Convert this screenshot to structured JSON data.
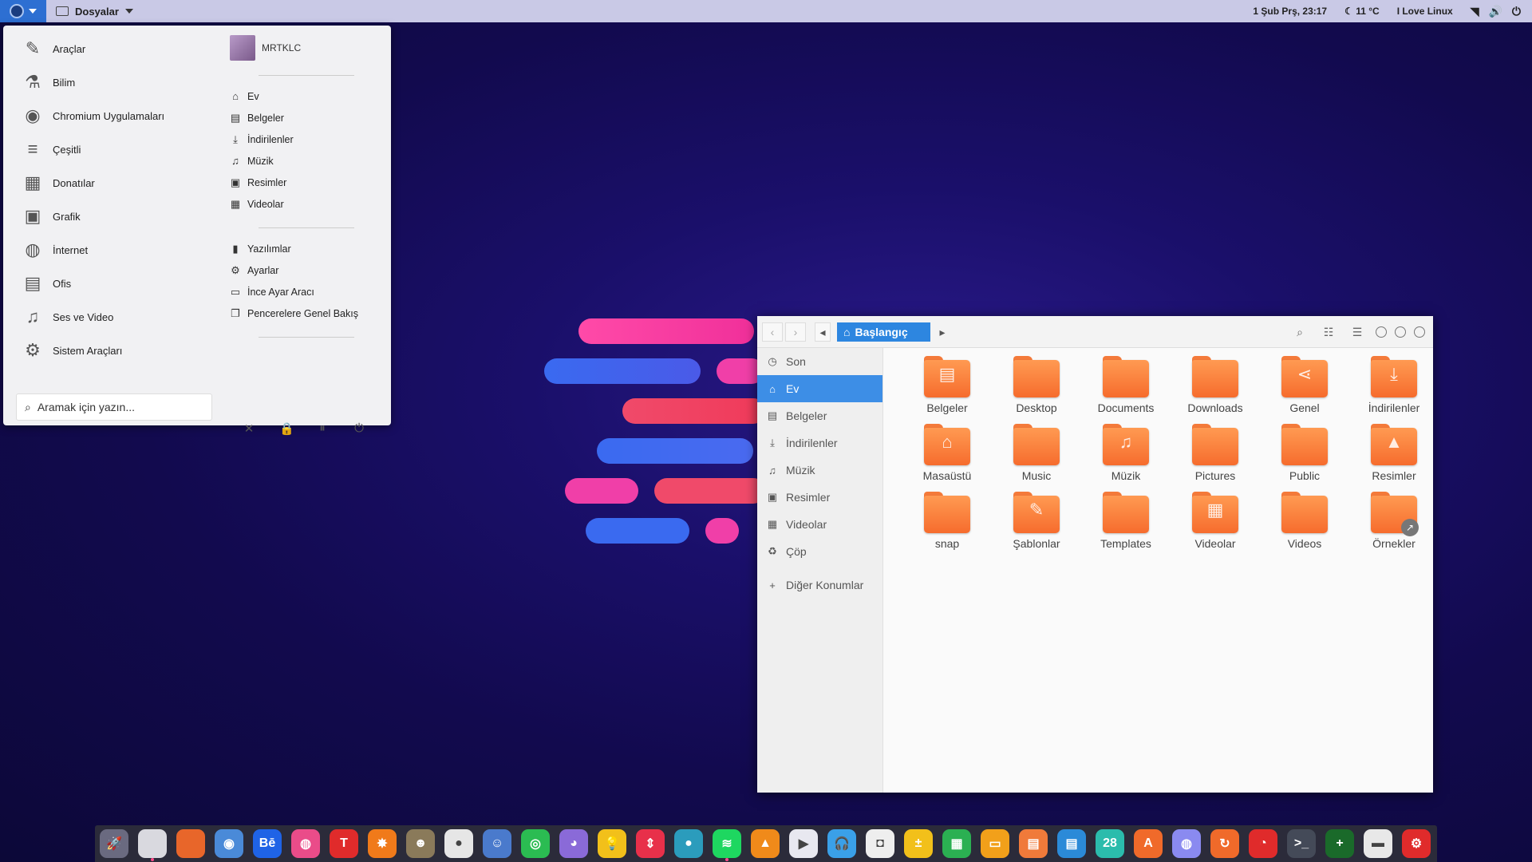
{
  "topbar": {
    "app_name": "Dosyalar",
    "datetime": "1 Şub Prş, 23:17",
    "weather": "11 °C",
    "tagline": "I Love Linux",
    "tray_icons": [
      "wifi-icon",
      "volume-icon",
      "power-icon"
    ]
  },
  "menu": {
    "categories": [
      {
        "label": "Araçlar",
        "icon": "tools-icon",
        "glyph": "✎"
      },
      {
        "label": "Bilim",
        "icon": "flask-icon",
        "glyph": "⚗"
      },
      {
        "label": "Chromium Uygulamaları",
        "icon": "chromium-icon",
        "glyph": "◉"
      },
      {
        "label": "Çeşitli",
        "icon": "misc-icon",
        "glyph": "≡"
      },
      {
        "label": "Donatılar",
        "icon": "accessories-icon",
        "glyph": "▦"
      },
      {
        "label": "Grafik",
        "icon": "graphics-icon",
        "glyph": "▣"
      },
      {
        "label": "İnternet",
        "icon": "internet-icon",
        "glyph": "◍"
      },
      {
        "label": "Ofis",
        "icon": "office-icon",
        "glyph": "▤"
      },
      {
        "label": "Ses ve Video",
        "icon": "music-icon",
        "glyph": "♫"
      },
      {
        "label": "Sistem Araçları",
        "icon": "system-icon",
        "glyph": "⚙"
      }
    ],
    "user": "MRTKLC",
    "places": [
      {
        "label": "Ev",
        "icon": "home-icon",
        "glyph": "⌂"
      },
      {
        "label": "Belgeler",
        "icon": "documents-icon",
        "glyph": "▤"
      },
      {
        "label": "İndirilenler",
        "icon": "downloads-icon",
        "glyph": "⤓"
      },
      {
        "label": "Müzik",
        "icon": "music-icon",
        "glyph": "♫"
      },
      {
        "label": "Resimler",
        "icon": "pictures-icon",
        "glyph": "▣"
      },
      {
        "label": "Videolar",
        "icon": "videos-icon",
        "glyph": "▦"
      }
    ],
    "system": [
      {
        "label": "Yazılımlar",
        "icon": "software-icon",
        "glyph": "▮"
      },
      {
        "label": "Ayarlar",
        "icon": "settings-icon",
        "glyph": "⚙"
      },
      {
        "label": "İnce Ayar Aracı",
        "icon": "tweaks-icon",
        "glyph": "▭"
      },
      {
        "label": "Pencerelere Genel Bakış",
        "icon": "overview-icon",
        "glyph": "❐"
      }
    ],
    "search_placeholder": "Aramak için yazın...",
    "power_buttons": [
      {
        "name": "close-icon",
        "glyph": "✕"
      },
      {
        "name": "lock-icon",
        "glyph": "🔒"
      },
      {
        "name": "suspend-icon",
        "glyph": "⏸"
      },
      {
        "name": "power-icon",
        "glyph": "⏻"
      }
    ]
  },
  "filemanager": {
    "path": "Başlangıç",
    "sidebar": [
      {
        "label": "Son",
        "icon": "recent-icon",
        "glyph": "◷"
      },
      {
        "label": "Ev",
        "icon": "home-icon",
        "glyph": "⌂",
        "active": true
      },
      {
        "label": "Belgeler",
        "icon": "documents-icon",
        "glyph": "▤"
      },
      {
        "label": "İndirilenler",
        "icon": "downloads-icon",
        "glyph": "⤓"
      },
      {
        "label": "Müzik",
        "icon": "music-icon",
        "glyph": "♫"
      },
      {
        "label": "Resimler",
        "icon": "pictures-icon",
        "glyph": "▣"
      },
      {
        "label": "Videolar",
        "icon": "videos-icon",
        "glyph": "▦"
      },
      {
        "label": "Çöp",
        "icon": "trash-icon",
        "glyph": "♻"
      },
      {
        "label": "Diğer Konumlar",
        "icon": "plus-icon",
        "glyph": "+"
      }
    ],
    "folders": [
      {
        "label": "Belgeler",
        "glyph": "▤"
      },
      {
        "label": "Desktop",
        "glyph": ""
      },
      {
        "label": "Documents",
        "glyph": ""
      },
      {
        "label": "Downloads",
        "glyph": ""
      },
      {
        "label": "Genel",
        "glyph": "⋖"
      },
      {
        "label": "İndirilenler",
        "glyph": "⤓"
      },
      {
        "label": "Masaüstü",
        "glyph": "⌂"
      },
      {
        "label": "Music",
        "glyph": ""
      },
      {
        "label": "Müzik",
        "glyph": "♫"
      },
      {
        "label": "Pictures",
        "glyph": ""
      },
      {
        "label": "Public",
        "glyph": ""
      },
      {
        "label": "Resimler",
        "glyph": "▲"
      },
      {
        "label": "snap",
        "glyph": ""
      },
      {
        "label": "Şablonlar",
        "glyph": "✎"
      },
      {
        "label": "Templates",
        "glyph": ""
      },
      {
        "label": "Videolar",
        "glyph": "▦"
      },
      {
        "label": "Videos",
        "glyph": ""
      },
      {
        "label": "Örnekler",
        "glyph": "",
        "badge": "↗"
      }
    ]
  },
  "dock": [
    {
      "name": "rocket-launcher-icon",
      "color": "#6a6a80",
      "glyph": "🚀"
    },
    {
      "name": "files-icon",
      "color": "#d9d9df",
      "glyph": "",
      "active": true
    },
    {
      "name": "firefox-icon",
      "color": "#e8662a",
      "glyph": ""
    },
    {
      "name": "chromium-icon",
      "color": "#4a8ad8",
      "glyph": "◉"
    },
    {
      "name": "behance-icon",
      "color": "#1f63e6",
      "glyph": "Bē"
    },
    {
      "name": "dribbble-icon",
      "color": "#ea4c89",
      "glyph": "◍"
    },
    {
      "name": "typora-icon",
      "color": "#e02b2b",
      "glyph": "T"
    },
    {
      "name": "spark-icon",
      "color": "#f07a1a",
      "glyph": "✸"
    },
    {
      "name": "gimp-icon",
      "color": "#8a7a5a",
      "glyph": "☻"
    },
    {
      "name": "camera-icon",
      "color": "#e6e6e6",
      "glyph": "●"
    },
    {
      "name": "github-icon",
      "color": "#4a7acc",
      "glyph": "☺"
    },
    {
      "name": "whatsapp-icon",
      "color": "#2bbc52",
      "glyph": "◎"
    },
    {
      "name": "pidgin-icon",
      "color": "#8a6ad8",
      "glyph": "◕"
    },
    {
      "name": "idea-icon",
      "color": "#f2c01a",
      "glyph": "💡"
    },
    {
      "name": "anydesk-icon",
      "color": "#e8304a",
      "glyph": "⇕"
    },
    {
      "name": "screencast-icon",
      "color": "#2b9cbc",
      "glyph": "●"
    },
    {
      "name": "spotify-icon",
      "color": "#1ed760",
      "glyph": "≋",
      "active": true
    },
    {
      "name": "vlc-icon",
      "color": "#f08a1a",
      "glyph": "▲"
    },
    {
      "name": "kdenlive-icon",
      "color": "#e8e8f0",
      "glyph": "▶"
    },
    {
      "name": "headphones-icon",
      "color": "#3aa0e8",
      "glyph": "🎧"
    },
    {
      "name": "steam-icon",
      "color": "#eeeeee",
      "glyph": "◘"
    },
    {
      "name": "calculator-icon",
      "color": "#f2c01a",
      "glyph": "±"
    },
    {
      "name": "spreadsheet-icon",
      "color": "#2bb052",
      "glyph": "▦"
    },
    {
      "name": "presentation-icon",
      "color": "#f2a01a",
      "glyph": "▭"
    },
    {
      "name": "slides-icon",
      "color": "#f07a3a",
      "glyph": "▤"
    },
    {
      "name": "writer-icon",
      "color": "#2b8ad8",
      "glyph": "▤"
    },
    {
      "name": "calendar-icon",
      "color": "#2bbcac",
      "glyph": "28"
    },
    {
      "name": "software-center-icon",
      "color": "#f06a2a",
      "glyph": "A"
    },
    {
      "name": "discord-icon",
      "color": "#8a8af0",
      "glyph": "◍"
    },
    {
      "name": "sync-icon",
      "color": "#f06a2a",
      "glyph": "↻"
    },
    {
      "name": "speedometer-icon",
      "color": "#e02b2b",
      "glyph": "◔"
    },
    {
      "name": "terminal-icon",
      "color": "#444a58",
      "glyph": ">_"
    },
    {
      "name": "system-monitor-icon",
      "color": "#1a6a2a",
      "glyph": "+"
    },
    {
      "name": "settings-panel-icon",
      "color": "#e8e8e8",
      "glyph": "▬"
    },
    {
      "name": "power-settings-icon",
      "color": "#e02b2b",
      "glyph": "⚙"
    }
  ],
  "deco_colors": {
    "pink": "#ff3fa8",
    "blue": "#3a6af0",
    "red": "#f0405a"
  }
}
